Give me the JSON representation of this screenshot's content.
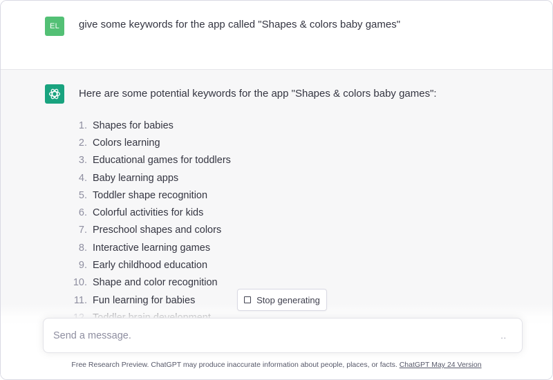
{
  "user_message": {
    "avatar_initials": "EL",
    "text": "give some keywords for the app called \"Shapes & colors baby games\""
  },
  "assistant_message": {
    "avatar_icon": "openai-logo-icon",
    "intro": "Here are some potential keywords for the app \"Shapes & colors baby games\":",
    "keywords": [
      {
        "num": "1.",
        "text": "Shapes for babies"
      },
      {
        "num": "2.",
        "text": "Colors learning"
      },
      {
        "num": "3.",
        "text": "Educational games for toddlers"
      },
      {
        "num": "4.",
        "text": "Baby learning apps"
      },
      {
        "num": "5.",
        "text": "Toddler shape recognition"
      },
      {
        "num": "6.",
        "text": "Colorful activities for kids"
      },
      {
        "num": "7.",
        "text": "Preschool shapes and colors"
      },
      {
        "num": "8.",
        "text": "Interactive learning games"
      },
      {
        "num": "9.",
        "text": "Early childhood education"
      },
      {
        "num": "10.",
        "text": "Shape and color recognition"
      },
      {
        "num": "11.",
        "text": "Fun learning for babies"
      },
      {
        "num": "12.",
        "text": "Toddler brain development"
      }
    ]
  },
  "stop_button": {
    "label": "Stop generating",
    "icon": "stop-square-icon"
  },
  "composer": {
    "placeholder": "Send a message.",
    "status_indicator": ".."
  },
  "footer": {
    "text": "Free Research Preview. ChatGPT may produce inaccurate information about people, places, or facts. ",
    "link_text": "ChatGPT May 24 Version"
  },
  "colors": {
    "user_avatar_bg": "#53c075",
    "bot_avatar_bg": "#19a37f",
    "assistant_row_bg": "#f7f7f8",
    "text": "#343541"
  }
}
